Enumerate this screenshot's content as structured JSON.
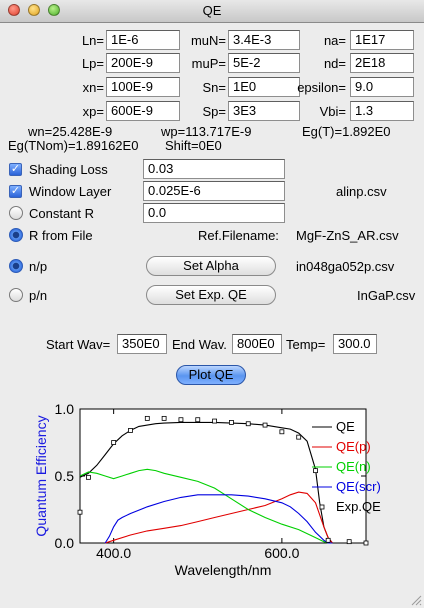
{
  "window": {
    "title": "QE"
  },
  "params": [
    {
      "key": "ln",
      "label": "Ln=",
      "value": "1E-6"
    },
    {
      "key": "lp",
      "label": "Lp=",
      "value": "200E-9"
    },
    {
      "key": "xn",
      "label": "xn=",
      "value": "100E-9"
    },
    {
      "key": "xp",
      "label": "xp=",
      "value": "600E-9"
    },
    {
      "key": "mun",
      "label": "muN=",
      "value": "3.4E-3"
    },
    {
      "key": "mup",
      "label": "muP=",
      "value": "5E-2"
    },
    {
      "key": "sn",
      "label": "Sn=",
      "value": "1E0"
    },
    {
      "key": "sp",
      "label": "Sp=",
      "value": "3E3"
    },
    {
      "key": "na",
      "label": "na=",
      "value": "1E17"
    },
    {
      "key": "nd",
      "label": "nd=",
      "value": "2E18"
    },
    {
      "key": "epsilon",
      "label": "epsilon=",
      "value": "9.0"
    },
    {
      "key": "vbi",
      "label": "Vbi=",
      "value": "1.3"
    }
  ],
  "results": {
    "wn": "wn=25.428E-9",
    "wp": "wp=113.717E-9",
    "egt": "Eg(T)=1.892E0",
    "egtnom": "Eg(TNom)=1.89162E0",
    "shift": "Shift=0E0"
  },
  "options": {
    "shading": {
      "label": "Shading Loss",
      "value": "0.03"
    },
    "window_layer": {
      "label": "Window Layer",
      "value": "0.025E-6",
      "file": "alinp.csv"
    },
    "constant_r": {
      "label": "Constant R",
      "value": "0.0"
    },
    "r_from_file": {
      "label": "R from File",
      "ref_label": "Ref.Filename:",
      "ref_file": "MgF-ZnS_AR.csv"
    }
  },
  "polarity": {
    "np": {
      "label": "n/p",
      "button": "Set Alpha",
      "file": "in048ga052p.csv"
    },
    "pn": {
      "label": "p/n",
      "button": "Set Exp. QE",
      "file": "InGaP.csv"
    }
  },
  "sweep": {
    "start_label": "Start Wav=",
    "start_value": "350E0",
    "end_label": "End Wav.",
    "end_value": "800E0",
    "temp_label": "Temp=",
    "temp_value": "300.0"
  },
  "plot_button": "Plot QE",
  "chart_data": {
    "type": "line",
    "xlabel": "Wavelength/nm",
    "ylabel": "Quantum Efficiency",
    "xlim": [
      360,
      700
    ],
    "ylim": [
      0,
      1.0
    ],
    "xticks": [
      400,
      600
    ],
    "xtick_labels": [
      "400.0",
      "600.0"
    ],
    "yticks": [
      0,
      0.5,
      1.0
    ],
    "ytick_labels": [
      "0.0",
      "0.5",
      "1.0"
    ],
    "legend_position": "right",
    "series": [
      {
        "name": "QE",
        "color": "#000000",
        "style": "line",
        "x": [
          360,
          370,
          380,
          390,
          400,
          410,
          420,
          430,
          440,
          450,
          460,
          480,
          500,
          520,
          540,
          560,
          580,
          600,
          610,
          620,
          630,
          640,
          645,
          650,
          655,
          660,
          670,
          680,
          700
        ],
        "y": [
          0.49,
          0.52,
          0.58,
          0.66,
          0.74,
          0.8,
          0.84,
          0.87,
          0.88,
          0.89,
          0.895,
          0.9,
          0.9,
          0.9,
          0.895,
          0.89,
          0.88,
          0.86,
          0.85,
          0.82,
          0.76,
          0.55,
          0.3,
          0.12,
          0.04,
          0.0,
          0.0,
          0.0,
          0.0
        ]
      },
      {
        "name": "QE(p)",
        "color": "#e00000",
        "style": "line",
        "x": [
          390,
          400,
          420,
          440,
          460,
          480,
          500,
          520,
          540,
          560,
          580,
          600,
          610,
          620,
          630,
          640,
          650,
          655,
          660
        ],
        "y": [
          0.0,
          0.02,
          0.06,
          0.09,
          0.11,
          0.13,
          0.16,
          0.19,
          0.22,
          0.25,
          0.28,
          0.33,
          0.36,
          0.38,
          0.37,
          0.3,
          0.12,
          0.04,
          0.0
        ]
      },
      {
        "name": "QE(n)",
        "color": "#00d000",
        "style": "line",
        "x": [
          360,
          370,
          380,
          390,
          400,
          410,
          420,
          430,
          440,
          450,
          460,
          480,
          500,
          520,
          540,
          560,
          580,
          600,
          620,
          630,
          640,
          650,
          655,
          660
        ],
        "y": [
          0.5,
          0.53,
          0.52,
          0.5,
          0.48,
          0.5,
          0.52,
          0.54,
          0.55,
          0.54,
          0.52,
          0.49,
          0.46,
          0.41,
          0.33,
          0.25,
          0.19,
          0.14,
          0.1,
          0.07,
          0.04,
          0.01,
          0.0,
          0.0
        ]
      },
      {
        "name": "QE(scr)",
        "color": "#0000e0",
        "style": "line",
        "x": [
          390,
          395,
          400,
          405,
          410,
          420,
          440,
          460,
          480,
          500,
          520,
          540,
          560,
          580,
          600,
          610,
          620,
          630,
          640,
          650,
          655,
          660
        ],
        "y": [
          0.0,
          0.05,
          0.12,
          0.17,
          0.19,
          0.22,
          0.27,
          0.31,
          0.34,
          0.36,
          0.36,
          0.36,
          0.35,
          0.33,
          0.3,
          0.27,
          0.22,
          0.16,
          0.08,
          0.02,
          0.0,
          0.0
        ]
      },
      {
        "name": "Exp.QE",
        "color": "#000000",
        "style": "markers",
        "x": [
          360,
          370,
          400,
          420,
          440,
          460,
          480,
          500,
          520,
          540,
          560,
          580,
          600,
          620,
          640,
          655,
          680,
          700
        ],
        "y": [
          0.23,
          0.49,
          0.75,
          0.84,
          0.93,
          0.93,
          0.92,
          0.92,
          0.91,
          0.9,
          0.89,
          0.88,
          0.83,
          0.79,
          0.54,
          0.02,
          0.01,
          0.0
        ]
      }
    ]
  }
}
